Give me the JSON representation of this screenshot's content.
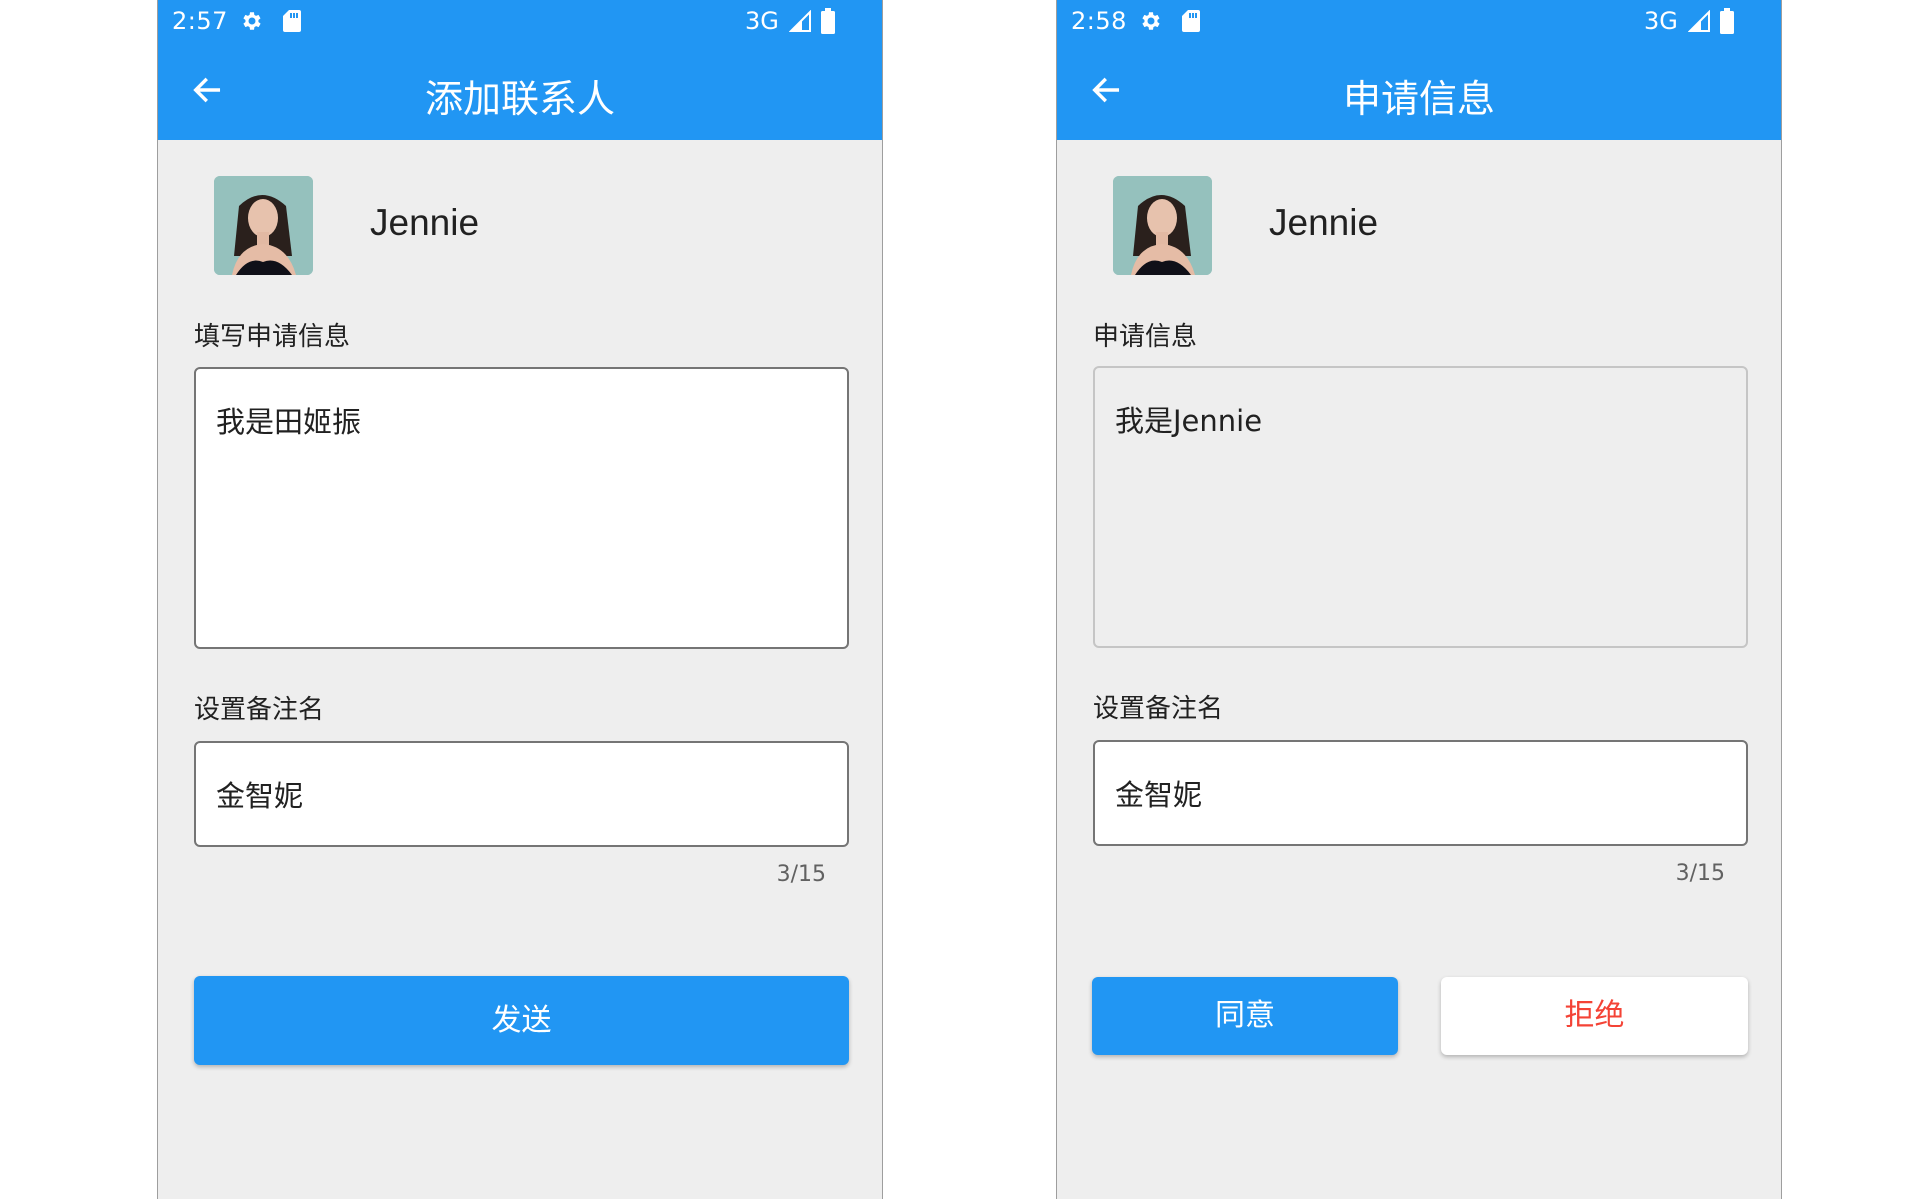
{
  "colors": {
    "primary": "#2196f3",
    "danger": "#f44336",
    "background": "#eeeeee"
  },
  "left_screen": {
    "status_bar": {
      "time": "2:57",
      "network": "3G",
      "icons": [
        "gear-icon",
        "sd-card-icon",
        "signal-icon",
        "battery-icon"
      ]
    },
    "app_bar": {
      "back_icon": "arrow-left-icon",
      "title": "添加联系人"
    },
    "contact": {
      "name": "Jennie",
      "avatar": "avatar-image"
    },
    "request_label": "填写申请信息",
    "request_message": "我是田姬振",
    "remark_label": "设置备注名",
    "remark_value": "金智妮",
    "remark_counter": "3/15",
    "send_button": "发送"
  },
  "right_screen": {
    "status_bar": {
      "time": "2:58",
      "network": "3G",
      "icons": [
        "gear-icon",
        "sd-card-icon",
        "signal-icon",
        "battery-icon"
      ]
    },
    "app_bar": {
      "back_icon": "arrow-left-icon",
      "title": "申请信息"
    },
    "contact": {
      "name": "Jennie",
      "avatar": "avatar-image"
    },
    "request_label": "申请信息",
    "request_message": "我是Jennie",
    "remark_label": "设置备注名",
    "remark_value": "金智妮",
    "remark_counter": "3/15",
    "accept_button": "同意",
    "reject_button": "拒绝"
  }
}
